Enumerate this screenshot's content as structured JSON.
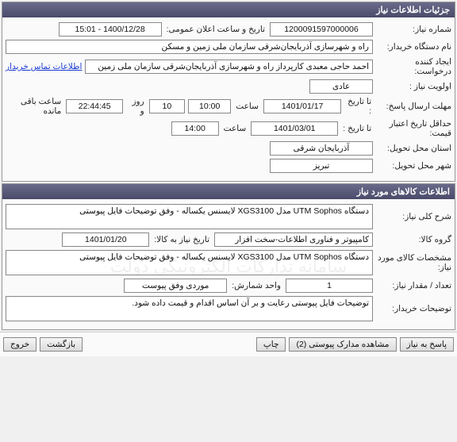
{
  "sections": {
    "need_info_title": "جزئیات اطلاعات نیاز",
    "goods_info_title": "اطلاعات کالاهای مورد نیاز"
  },
  "labels": {
    "need_number": "شماره نیاز:",
    "announce_datetime": "تاریخ و ساعت اعلان عمومی:",
    "buyer_org": "نام دستگاه خریدار:",
    "request_creator": "ایجاد کننده درخواست:",
    "contact_link": "اطلاعات تماس خریدار",
    "priority": "اولویت نیاز :",
    "response_deadline": "مهلت ارسال پاسخ:",
    "to_date": "تا تاریخ :",
    "at_time": "ساعت",
    "days_and": "روز و",
    "hours_remaining": "ساعت باقی مانده",
    "price_validity": "حداقل تاریخ اعتبار قیمت:",
    "delivery_province": "استان محل تحویل:",
    "delivery_city": "شهر محل تحویل:",
    "need_desc": "شرح کلی نیاز:",
    "goods_group": "گروه کالا:",
    "need_date": "تاریخ نیاز به کالا:",
    "goods_spec": "مشخصات کالای مورد نیاز:",
    "qty": "تعداد / مقدار نیاز:",
    "count_unit": "واحد شمارش:",
    "buyer_notes": "توضیحات خریدار:"
  },
  "values": {
    "need_number": "1200091597000006",
    "announce_datetime": "1400/12/28 - 15:01",
    "buyer_org": "راه و شهرسازی آذربایجان‌شرقی   سازمان ملی زمین و مسکن",
    "request_creator": "احمد حاجی معبدی کارپرداز راه و شهرسازی آذربایجان‌شرقی   سازمان ملی زمین",
    "priority": "عادی",
    "deadline_date": "1401/01/17",
    "deadline_time": "10:00",
    "remain_days": "10",
    "remain_time": "22:44:45",
    "validity_date": "1401/03/01",
    "validity_time": "14:00",
    "province": "آذربایجان شرقی",
    "city": "تبریز",
    "need_desc": "دستگاه UTM Sophos مدل XGS3100 لایسنس یکساله - وفق توضیحات فایل پیوستی",
    "goods_group": "کامپیوتر و فناوری اطلاعات-سخت افزار",
    "need_date": "1401/01/20",
    "goods_spec": "دستگاه UTM Sophos مدل XGS3100 لایسنس یکساله - وفق توضیحات فایل پیوستی",
    "qty": "1",
    "count_unit": "موردی وفق پیوست",
    "buyer_notes": "توضیحات فایل پیوستی رعایت و بر آن اساس اقدام و قیمت داده شود."
  },
  "buttons": {
    "respond": "پاسخ به نیاز",
    "view_attachments": "مشاهده مدارک پیوستی (2)",
    "print": "چاپ",
    "back": "بازگشت",
    "exit": "خروج"
  }
}
